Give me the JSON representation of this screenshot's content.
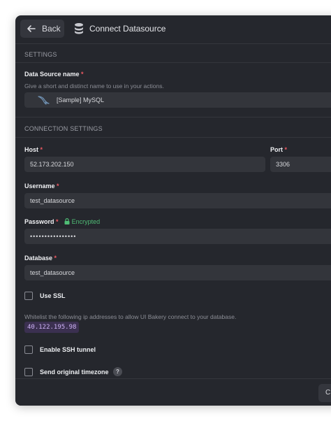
{
  "header": {
    "back_label": "Back",
    "title": "Connect Datasource"
  },
  "settings": {
    "section_title": "SETTINGS",
    "datasource_name": {
      "label": "Data Source name",
      "required_mark": "*",
      "hint": "Give a short and distinct name to use in your actions.",
      "value": "[Sample] MySQL"
    }
  },
  "connection": {
    "section_title": "CONNECTION SETTINGS",
    "host": {
      "label": "Host",
      "required_mark": "*",
      "value": "52.173.202.150"
    },
    "port": {
      "label": "Port",
      "required_mark": "*",
      "value": "3306"
    },
    "username": {
      "label": "Username",
      "required_mark": "*",
      "value": "test_datasource"
    },
    "password": {
      "label": "Password",
      "required_mark": "*",
      "encrypted_label": "Encrypted",
      "value": "••••••••••••••••"
    },
    "database": {
      "label": "Database",
      "required_mark": "*",
      "value": "test_datasource"
    },
    "use_ssl": {
      "label": "Use SSL",
      "checked": false
    },
    "whitelist_hint": "Whitelist the following ip addresses to allow UI Bakery connect to your database.",
    "whitelist_ip": "40.122.195.98",
    "ssh_tunnel": {
      "label": "Enable SSH tunnel",
      "checked": false
    },
    "original_timezone": {
      "label": "Send original timezone",
      "checked": false,
      "help": "?"
    }
  },
  "footer": {
    "button_label": "C"
  },
  "colors": {
    "background": "#25272d",
    "input": "#33353b",
    "required": "#ef5a63",
    "encrypted": "#4fbd75",
    "ip_badge": "#3b3050"
  }
}
